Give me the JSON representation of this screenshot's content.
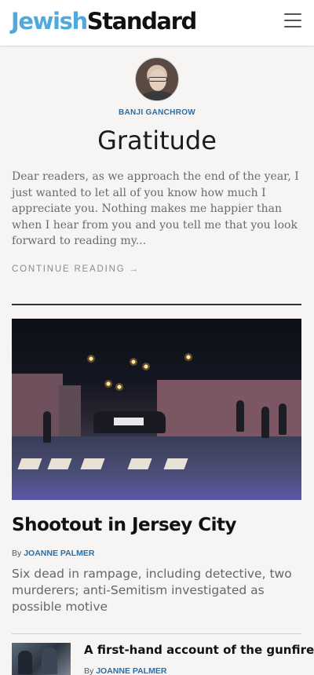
{
  "header": {
    "logo_part1": "Jewish",
    "logo_part2": "Standard",
    "menu_icon": "hamburger-menu-icon"
  },
  "featured": {
    "author": "BANJI GANCHROW",
    "title": "Gratitude",
    "excerpt": "Dear readers, as we approach the end of the year, I just wanted to let all of you know how much I appreciate you. Nothing makes me happier than when I hear from you and you tell me that you look forward to reading my...",
    "continue_label": "CONTINUE READING →"
  },
  "story1": {
    "title": "Shootout in Jersey City",
    "by_prefix": "By",
    "author": "JOANNE PALMER",
    "deck": "Six dead in rampage, including detective, two murderers; anti-Semitism investigated as possible motive"
  },
  "story2": {
    "title": "A first-hand account of the gunfire",
    "by_prefix": "By",
    "author": "JOANNE PALMER"
  },
  "colors": {
    "brand_blue": "#4ea9dc",
    "link_blue": "#2a6ea8",
    "background": "#f6f5f3"
  }
}
